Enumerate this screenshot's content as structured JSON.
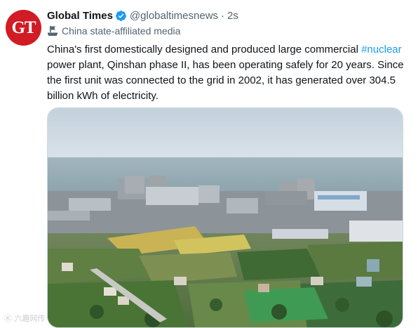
{
  "tweet": {
    "avatar_text": "GT",
    "author_name": "Global Times",
    "verified_icon": "verified-badge-icon",
    "handle": "@globaltimesnews",
    "separator": "·",
    "time": "2s",
    "affiliation": "China state-affiliated media",
    "text_before": "China's first domestically designed and produced large commercial ",
    "hashtag": "#nuclear",
    "text_after": " power plant, Qinshan phase II, has been operating safely for 20 years. Since the first unit was connected to the grid in 2002, it has generated over 304.5 billion kWh of electricity."
  },
  "watermark": "Ⓚ 六趣网传",
  "colors": {
    "link": "#1d9bf0",
    "secondary_text": "#536471",
    "verified": "#1d9bf0",
    "avatar_bg": "#d11b25"
  }
}
